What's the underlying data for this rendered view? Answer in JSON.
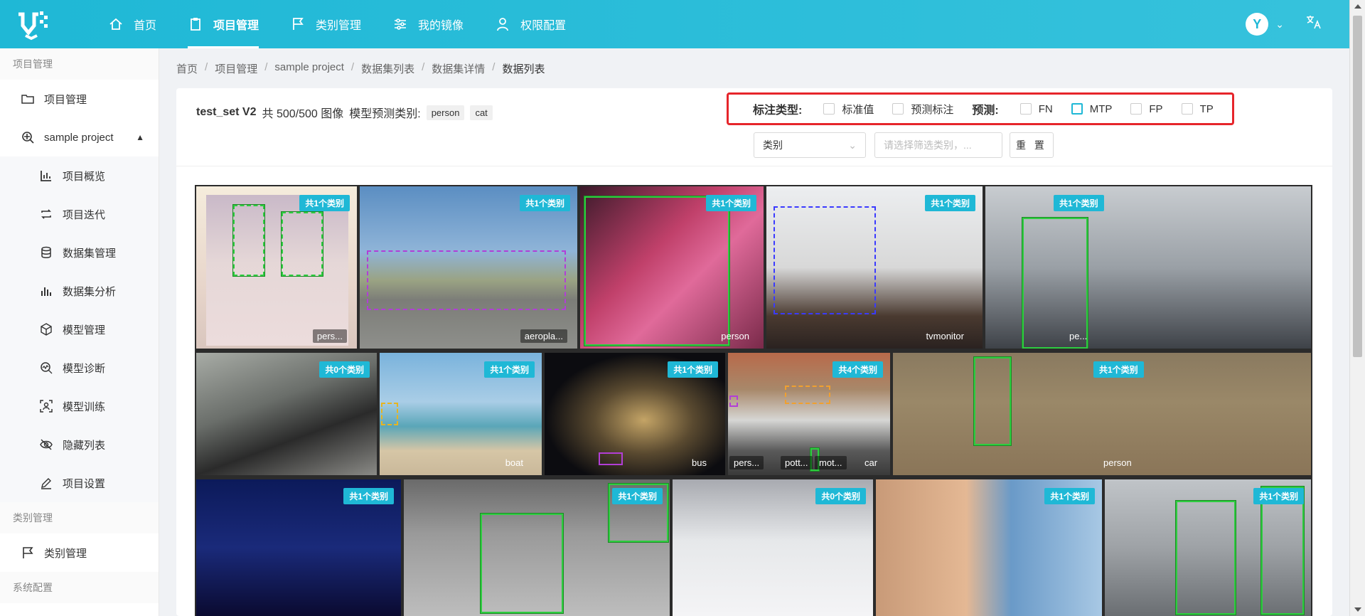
{
  "nav": {
    "items": [
      {
        "label": "首页",
        "icon": "home-icon"
      },
      {
        "label": "项目管理",
        "icon": "clipboard-icon"
      },
      {
        "label": "类别管理",
        "icon": "flag-icon"
      },
      {
        "label": "我的镜像",
        "icon": "sliders-icon"
      },
      {
        "label": "权限配置",
        "icon": "user-icon"
      }
    ],
    "avatar_initial": "Y",
    "active_index": 1
  },
  "sidebar": {
    "group1": "项目管理",
    "item_project": "项目管理",
    "item_sample": "sample project",
    "sub": [
      {
        "label": "项目概览",
        "icon": "bar-chart-icon"
      },
      {
        "label": "项目迭代",
        "icon": "repeat-icon"
      },
      {
        "label": "数据集管理",
        "icon": "database-icon"
      },
      {
        "label": "数据集分析",
        "icon": "analytics-icon"
      },
      {
        "label": "模型管理",
        "icon": "cube-icon"
      },
      {
        "label": "模型诊断",
        "icon": "diagnosis-icon"
      },
      {
        "label": "模型训练",
        "icon": "training-icon"
      },
      {
        "label": "隐藏列表",
        "icon": "eye-off-icon"
      },
      {
        "label": "项目设置",
        "icon": "edit-icon"
      }
    ],
    "group2": "类别管理",
    "item_category": "类别管理",
    "group3": "系统配置"
  },
  "breadcrumb": [
    "首页",
    "项目管理",
    "sample project",
    "数据集列表",
    "数据集详情",
    "数据列表"
  ],
  "header": {
    "dataset_name": "test_set V2",
    "count_text": "共 500/500 图像",
    "pred_label": "模型预测类别:",
    "pred_tags": [
      "person",
      "cat"
    ]
  },
  "filter": {
    "anno_type_label": "标注类型:",
    "opt_gt": "标准值",
    "opt_pred": "预测标注",
    "pred_label": "预测:",
    "opt_fn": "FN",
    "opt_mtp": "MTP",
    "opt_fp": "FP",
    "opt_tp": "TP",
    "type_select": "类别",
    "category_placeholder": "请选择筛选类别，...",
    "reset": "重 置"
  },
  "tiles": [
    {
      "badge": "共1个类别",
      "labels": [
        "pers..."
      ]
    },
    {
      "badge": "共1个类别",
      "labels": [
        "aeropla..."
      ]
    },
    {
      "badge": "共1个类别",
      "labels": [
        "person"
      ]
    },
    {
      "badge": "共1个类别",
      "labels": [
        "tvmonitor"
      ]
    },
    {
      "badge": "共1个类别",
      "labels": [
        "pe..."
      ]
    },
    {
      "badge": "共0个类别",
      "labels": []
    },
    {
      "badge": "共1个类别",
      "labels": [
        "boat"
      ]
    },
    {
      "badge": "共1个类别",
      "labels": [
        "bus"
      ]
    },
    {
      "badge": "共4个类别",
      "labels": [
        "pers...",
        "pott...",
        "mot...",
        "car"
      ]
    },
    {
      "badge": "共1个类别",
      "labels": [
        "person"
      ]
    },
    {
      "badge": "共1个类别",
      "labels": []
    },
    {
      "badge": "共1个类别",
      "labels": []
    },
    {
      "badge": "共0个类别",
      "labels": []
    },
    {
      "badge": "共1个类别",
      "labels": []
    },
    {
      "badge": "共1个类别",
      "labels": []
    }
  ]
}
